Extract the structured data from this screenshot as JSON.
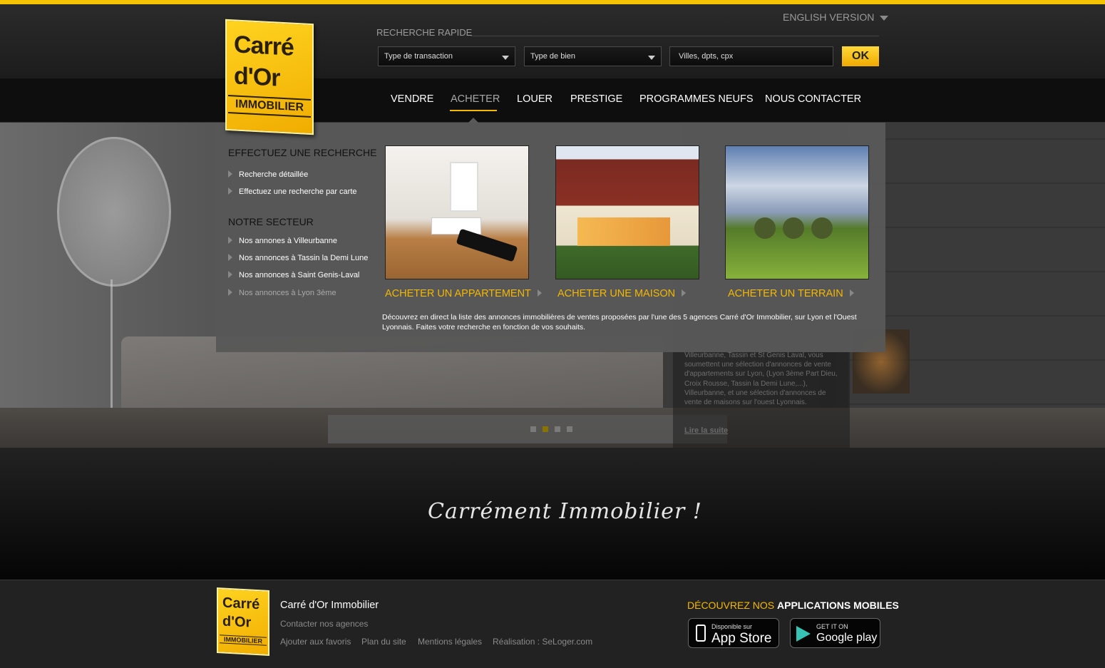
{
  "header": {
    "english_version": "ENGLISH VERSION",
    "logo": {
      "line1": "Carré",
      "line2": "d'Or",
      "line3": "IMMOBILIER"
    },
    "quick_search": {
      "label": "RECHERCHE RAPIDE",
      "transaction_type": "Type de transaction",
      "property_type": "Type de bien",
      "location_placeholder": "Villes, dpts, cpx",
      "ok_label": "OK"
    },
    "accent_color": "#f5b800"
  },
  "nav": {
    "items": [
      "VENDRE",
      "ACHETER",
      "LOUER",
      "PRESTIGE",
      "PROGRAMMES NEUFS",
      "NOUS CONTACTER"
    ],
    "active": "ACHETER"
  },
  "mega_menu": {
    "search_heading": "EFFECTUEZ UNE RECHERCHE",
    "search_links": [
      "Recherche détaillée",
      "Effectuez une recherche par carte"
    ],
    "sector_heading": "NOTRE SECTEUR",
    "sector_links": [
      "Nos annones à Villeurbanne",
      "Nos annonces à Tassin la Demi Lune",
      "Nos annonces à  Saint Genis-Laval",
      "Nos annonces à Lyon 3ème"
    ],
    "categories": [
      {
        "label": "ACHETER UN APPARTEMENT"
      },
      {
        "label": "ACHETER UNE MAISON"
      },
      {
        "label": "ACHETER UN TERRAIN"
      }
    ],
    "description": "Découvrez en direct la liste des annonces immobilières de ventes proposées par l'une des 5 agences Carré d'Or Immobilier, sur Lyon et l'Ouest Lyonnais. Faites votre recherche en fonction de vos souhaits."
  },
  "hero": {
    "text": "Villeurbanne, Tassin et St Genis Laval, vous soumettent une sélection d'annonces de vente d'appartements sur Lyon, (Lyon 3ème Part Dieu, Croix Rousse, Tassin la Demi Lune,...), Villeurbanne, et une sélection d'annonces de vente de maisons sur l'ouest Lyonnais.",
    "read_more": "Lire la suite"
  },
  "tagline": "Carrément Immobilier !",
  "footer": {
    "logo": {
      "line1": "Carré",
      "line2": "d'Or",
      "line3": "IMMOBILIER"
    },
    "company": "Carré d'Or Immobilier",
    "contact": "Contacter nos agences",
    "favorites": "Ajouter aux favoris",
    "sitemap": "Plan du site",
    "legal": "Mentions légales",
    "credit": "Réalisation : SeLoger.com",
    "apps_prefix": "DÉCOUVREZ NOS",
    "apps_title": "APPLICATIONS MOBILES",
    "app_store": {
      "small": "Disponible sur",
      "big": "App Store"
    },
    "google_play": {
      "small": "GET IT ON",
      "big": "Google play"
    }
  }
}
